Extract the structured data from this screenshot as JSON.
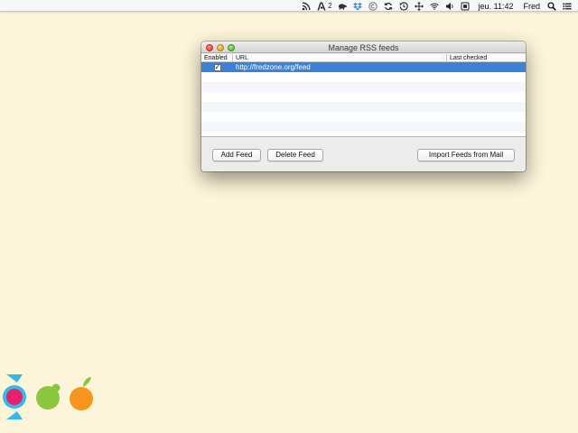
{
  "menubar": {
    "status_icons": [
      {
        "name": "rss-icon"
      },
      {
        "name": "adobe-icon",
        "count": "2"
      },
      {
        "name": "turtle-icon"
      },
      {
        "name": "dropbox-icon"
      },
      {
        "name": "copyright-circle-icon"
      },
      {
        "name": "sync-icon"
      },
      {
        "name": "time-machine-icon"
      },
      {
        "name": "move-arrows-icon"
      },
      {
        "name": "wifi-icon"
      },
      {
        "name": "volume-icon"
      },
      {
        "name": "input-source-icon"
      }
    ],
    "clock": "jeu. 11:42",
    "user": "Fred",
    "search_icon": "magnifier-icon",
    "notification_icon": "list-icon"
  },
  "window": {
    "title": "Manage RSS feeds",
    "columns": {
      "enabled": "Enabled",
      "url": "URL",
      "last_checked": "Last checked"
    },
    "feeds": [
      {
        "enabled": true,
        "url": "http://fredzone.org/feed",
        "last_checked": ""
      }
    ],
    "buttons": {
      "add": "Add Feed",
      "delete": "Delete Feed",
      "import": "Import Feeds from Mail"
    }
  },
  "colors": {
    "desktop": "#fdf5d9",
    "selection": "#3b82d6",
    "logo_pink": "#e8216f",
    "logo_cyan": "#33b9e3",
    "logo_green": "#8cc63f",
    "logo_orange": "#f7941d"
  }
}
